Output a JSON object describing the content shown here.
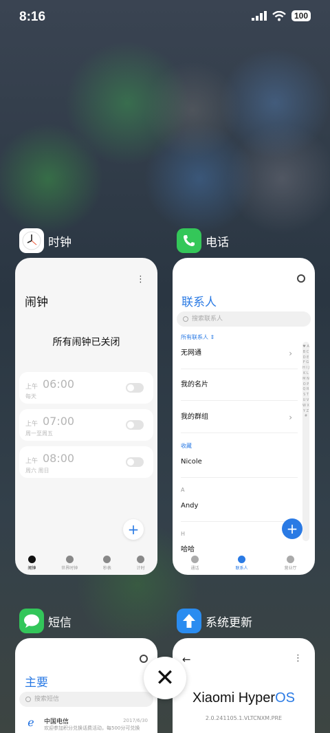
{
  "status_bar": {
    "time": "8:16",
    "battery": "100"
  },
  "cards": {
    "clock": {
      "app_name": "时钟",
      "title": "闹钟",
      "more": "⋮",
      "status": "所有闹钟已关闭",
      "alarms": [
        {
          "ampm": "上午",
          "time": "06:00",
          "repeat": "每天"
        },
        {
          "ampm": "上午",
          "time": "07:00",
          "repeat": "周一至周五"
        },
        {
          "ampm": "上午",
          "time": "08:00",
          "repeat": "周六 周日"
        }
      ],
      "add": "+",
      "nav": [
        "闹钟",
        "世界时钟",
        "秒表",
        "计时"
      ]
    },
    "phone": {
      "app_name": "电话",
      "title": "联系人",
      "search_placeholder": "搜索联系人",
      "group_label": "所有联系人 ⇕",
      "rows": [
        "无网通",
        "我的名片",
        "我的群组"
      ],
      "section_favorites": "收藏",
      "favorite": "Nicole",
      "section_a": "A",
      "contact_a": "Andy",
      "section_h": "H",
      "contact_h": "哈哈",
      "alpha": "♥ A B C D E F G H I J K L M N O P Q R S T U V W X Y Z #",
      "add": "+",
      "nav": [
        "通话",
        "联系人",
        "营业厅"
      ]
    },
    "sms": {
      "app_name": "短信",
      "title": "主要",
      "search_placeholder": "搜索短信",
      "sender": "中国电信",
      "date": "2017/6/30",
      "preview": "欢迎参加积分兑换话费活动，每500分可兑换"
    },
    "update": {
      "app_name": "系统更新",
      "back": "←",
      "more": "⋮",
      "brand_main": "Xiaomi Hyper",
      "brand_os": "OS",
      "version": "2.0.241105.1.VLTCNXM.PRE"
    }
  },
  "close_label": "✕",
  "colors": {
    "accent": "#2a7ae4",
    "phone_green": "#34c759",
    "sms_green": "#33c65a",
    "update_blue": "#2a8cf0"
  }
}
